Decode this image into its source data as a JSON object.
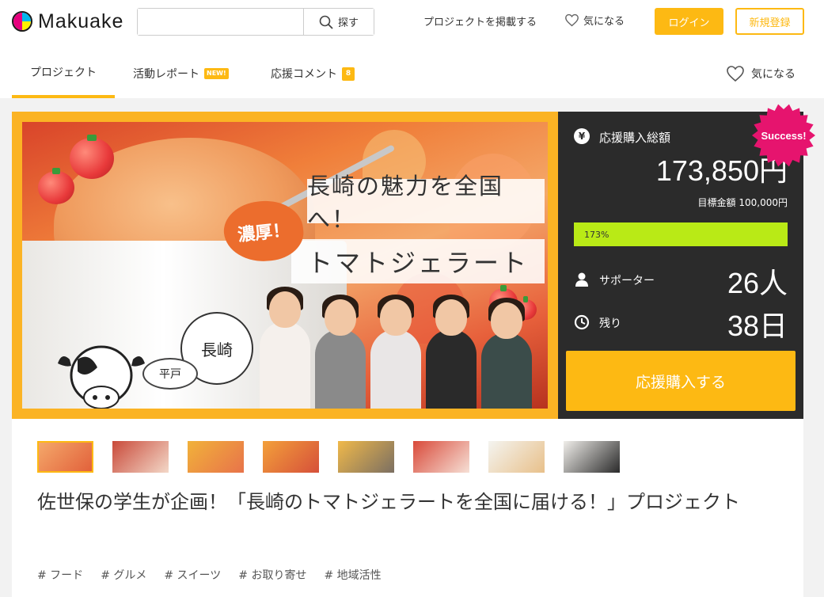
{
  "header": {
    "logo_text": "Makuake",
    "search_placeholder": "",
    "search_button": "探す",
    "post_project": "プロジェクトを掲載する",
    "favorite": "気になる",
    "login": "ログイン",
    "signup": "新規登録"
  },
  "tabs": {
    "projects": "プロジェクト",
    "reports": "活動レポート",
    "reports_badge": "NEW!",
    "comments": "応援コメント",
    "comments_count": "8",
    "favorite": "気になる"
  },
  "hero": {
    "headline_top": "長崎の魅力を全国へ！",
    "headline_bottom": "トマトジェラート",
    "burst_text": "濃厚！",
    "logo_text": "長崎",
    "sign_text": "平戸"
  },
  "stats": {
    "total_label": "応援購入総額",
    "total_amount": "173,850円",
    "goal_text": "目標金額 100,000円",
    "progress_percent": 173,
    "progress_label": "173%",
    "supporters_label": "サポーター",
    "supporters_value": "26人",
    "remaining_label": "残り",
    "remaining_value": "38日",
    "buy_button": "応援購入する",
    "success_badge": "Success!"
  },
  "thumbnails": {
    "count": 8,
    "selected_index": 0
  },
  "project": {
    "title": "佐世保の学生が企画！「長崎のトマトジェラートを全国に届ける！」プロジェクト",
    "tags": [
      "# フード",
      "# グルメ",
      "# スイーツ",
      "# お取り寄せ",
      "# 地域活性"
    ]
  },
  "colors": {
    "accent": "#fdb913",
    "progress": "#b9ea16",
    "panel": "#2b2b2b",
    "success": "#e6146e"
  }
}
